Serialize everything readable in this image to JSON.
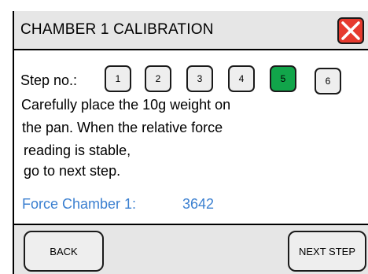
{
  "header": {
    "title": "CHAMBER 1 CALIBRATION",
    "close_icon": "close-x-icon",
    "close_color": "#e63a2e"
  },
  "steps": {
    "label": "Step no.:",
    "items": [
      "1",
      "2",
      "3",
      "4",
      "5",
      "6"
    ],
    "active": "5",
    "active_color": "#11a54a"
  },
  "instructions": {
    "lines": [
      "Carefully place the 10g weight on",
      "the pan. When the relative force",
      "reading is stable,",
      "go to next step."
    ]
  },
  "force": {
    "label": "Force Chamber 1:",
    "value": "3642",
    "color": "#3a7fd0"
  },
  "footer": {
    "back_label": "BACK",
    "next_label": "NEXT STEP"
  }
}
